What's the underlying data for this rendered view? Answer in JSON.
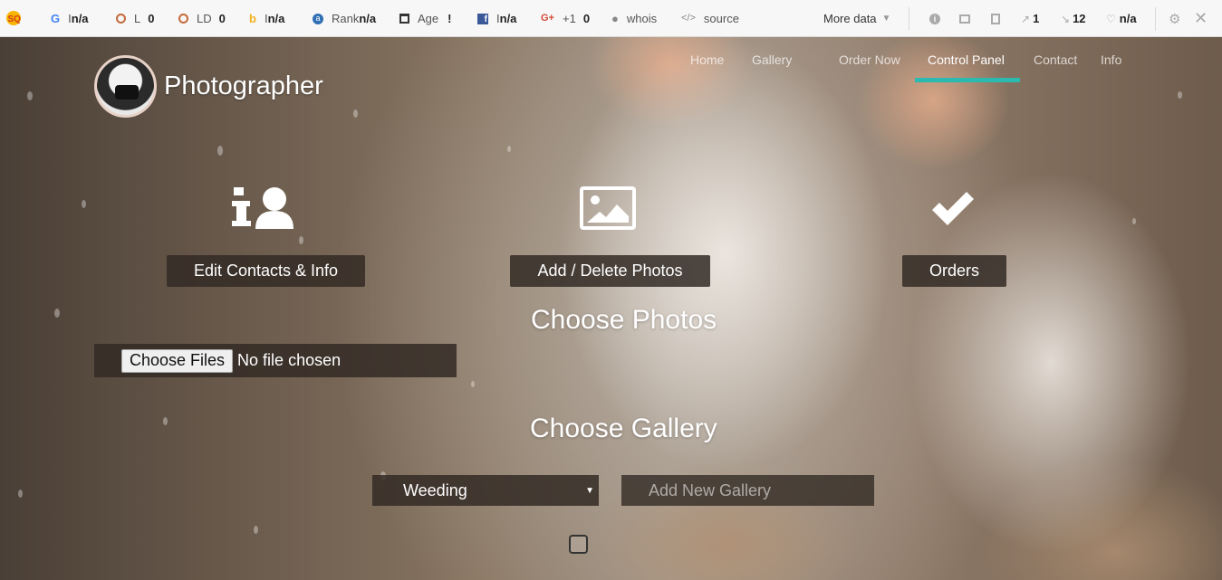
{
  "seo_toolbar": {
    "items": [
      {
        "label": "I",
        "value": "n/a",
        "icon": "google-icon"
      },
      {
        "label": "L",
        "value": "0",
        "icon": "circle-icon"
      },
      {
        "label": "LD",
        "value": "0",
        "icon": "circle-icon"
      },
      {
        "label": "I",
        "value": "n/a",
        "icon": "bing-icon"
      },
      {
        "label": "Rank",
        "value": "n/a",
        "icon": "alexa-icon"
      },
      {
        "label": "Age",
        "value": "!",
        "icon": "calendar-icon"
      },
      {
        "label": "I",
        "value": "n/a",
        "icon": "facebook-icon"
      },
      {
        "label": "+1",
        "value": "0",
        "icon": "google-plus-icon"
      },
      {
        "label": "whois",
        "value": "",
        "icon": "user-icon"
      },
      {
        "label": "source",
        "value": "",
        "icon": "code-icon"
      }
    ],
    "more_data_label": "More data",
    "right_stats": [
      {
        "icon": "info-icon",
        "value": ""
      },
      {
        "icon": "screen-icon",
        "value": ""
      },
      {
        "icon": "page-icon",
        "value": ""
      },
      {
        "icon": "external-link-icon",
        "value": "1"
      },
      {
        "icon": "internal-link-icon",
        "value": "12"
      },
      {
        "icon": "heart-icon",
        "value": "n/a"
      }
    ],
    "colors": {
      "bar_bg": "#f7f7f7",
      "orange": "#c46a3b"
    }
  },
  "brand": {
    "title": "Photographer"
  },
  "nav": {
    "items": [
      "Home",
      "Gallery",
      "Order Now",
      "Control Panel",
      "Contact",
      "Info"
    ],
    "active": "Control Panel",
    "accent_color": "#2bb9b0"
  },
  "features": [
    {
      "icon": "info-user-icon",
      "label": "Edit Contacts & Info"
    },
    {
      "icon": "image-icon",
      "label": "Add / Delete Photos"
    },
    {
      "icon": "check-icon",
      "label": "Orders"
    }
  ],
  "choose_photos": {
    "title": "Choose Photos",
    "button_label": "Choose Files",
    "status": "No file chosen"
  },
  "choose_gallery": {
    "title": "Choose Gallery",
    "selected": "Weeding",
    "new_gallery_placeholder": "Add New Gallery"
  }
}
